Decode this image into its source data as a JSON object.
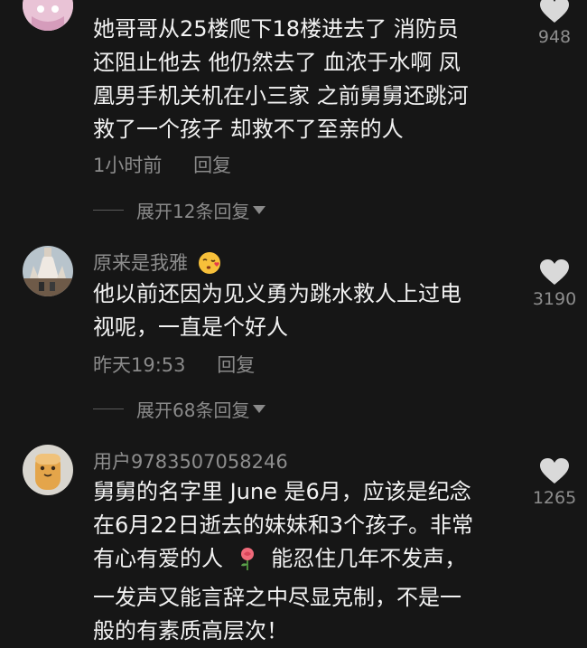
{
  "comments": [
    {
      "username": "",
      "text_lines": [
        "她哥哥从25楼爬下18楼进去了 消防员",
        "还阻止他去 他仍然去了 血浓于水啊 凤",
        "凰男手机关机在小三家 之前舅舅还跳河",
        "救了一个孩子 却救不了至亲的人"
      ],
      "time": "1小时前",
      "reply_label": "回复",
      "likes": "948",
      "expand_label": "展开12条回复"
    },
    {
      "username": "原来是我雅",
      "username_emoji": "kissing-face-emoji",
      "text_lines": [
        "他以前还因为见义勇为跳水救人上过电",
        "视呢，一直是个好人"
      ],
      "time": "昨天19:53",
      "reply_label": "回复",
      "likes": "3190",
      "expand_label": "展开68条回复"
    },
    {
      "username": "用户9783507058246",
      "text_lines": [
        "舅舅的名字里 June 是6月，应该是纪念",
        "在6月22日逝去的妹妹和3个孩子。非常",
        "有心有爱的人",
        "能忍住几年不发声，",
        "一发声又能言辞之中尽显克制，不是一",
        "般的有素质高层次！"
      ],
      "inline_emoji": "rose-emoji",
      "likes": "1265"
    }
  ],
  "colors": {
    "background": "#161616",
    "text_primary": "#f2f2f2",
    "text_secondary": "#8a8a8a",
    "heart": "#d9d9d9"
  }
}
